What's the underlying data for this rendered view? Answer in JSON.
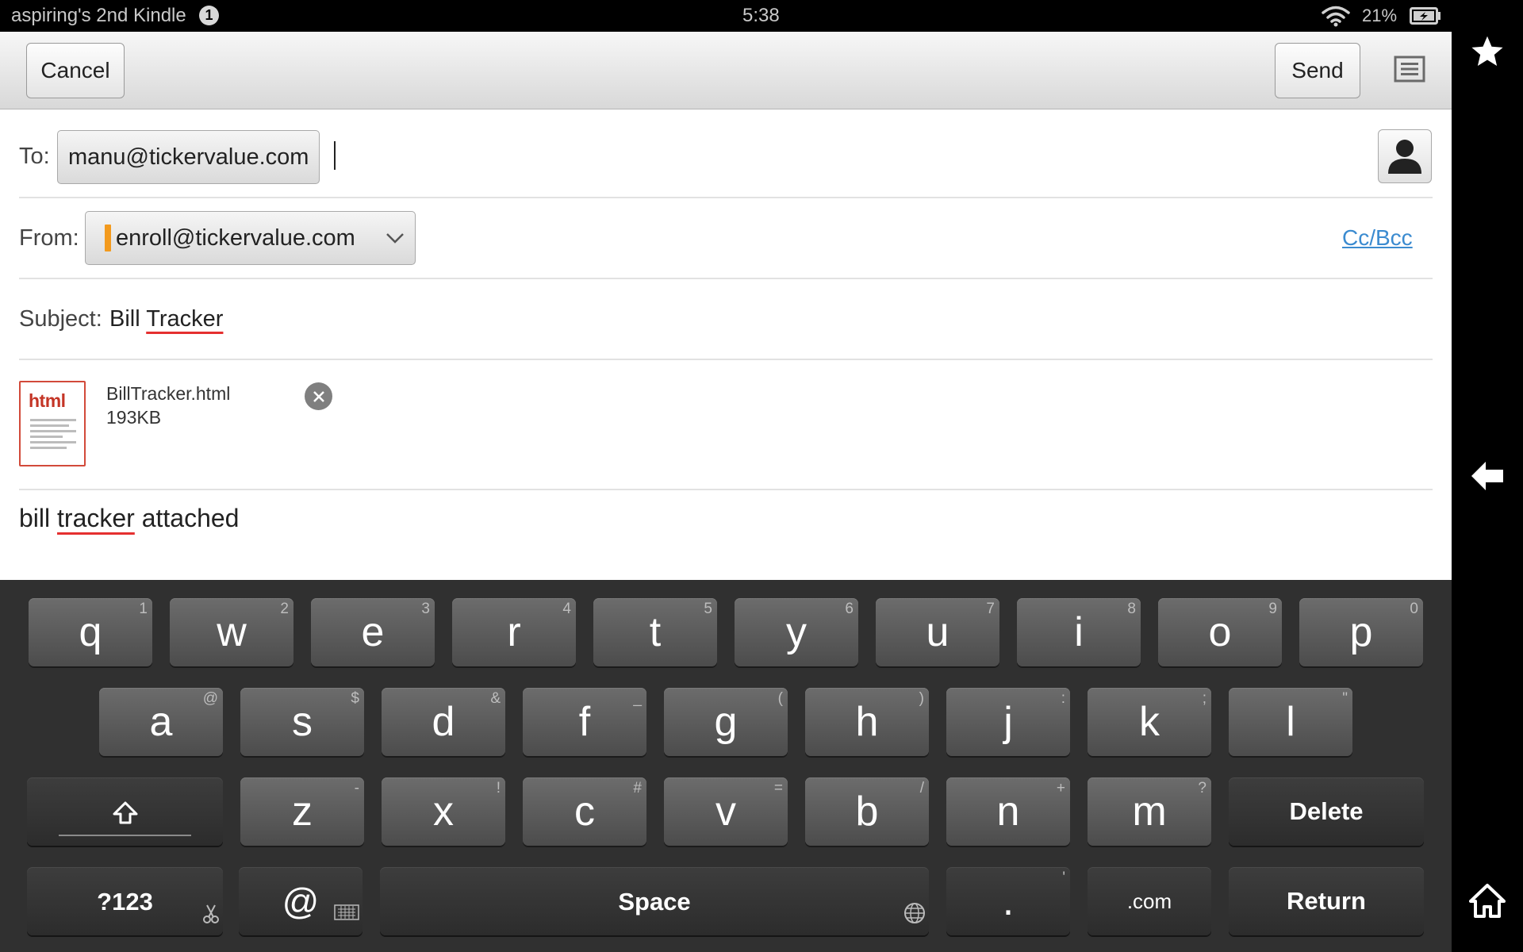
{
  "status_bar": {
    "device_name": "aspiring's 2nd Kindle",
    "notification_count": "1",
    "time": "5:38",
    "battery_percent": "21%"
  },
  "toolbar": {
    "cancel_label": "Cancel",
    "send_label": "Send"
  },
  "compose": {
    "to_label": "To:",
    "to_recipient": "manu@tickervalue.com",
    "from_label": "From:",
    "from_account": "enroll@tickervalue.com",
    "from_account_color": "#f39a1d",
    "cc_bcc_label": "Cc/Bcc",
    "subject_label": "Subject:",
    "subject_word1": "Bill",
    "subject_word2": "Tracker",
    "attachment": {
      "type_label": "html",
      "name": "BillTracker.html",
      "size": "193KB"
    },
    "body_word1": "bill",
    "body_word2": "tracker",
    "body_word3": "attached"
  },
  "keyboard": {
    "row1": [
      {
        "key": "q",
        "hint": "1"
      },
      {
        "key": "w",
        "hint": "2"
      },
      {
        "key": "e",
        "hint": "3"
      },
      {
        "key": "r",
        "hint": "4"
      },
      {
        "key": "t",
        "hint": "5"
      },
      {
        "key": "y",
        "hint": "6"
      },
      {
        "key": "u",
        "hint": "7"
      },
      {
        "key": "i",
        "hint": "8"
      },
      {
        "key": "o",
        "hint": "9"
      },
      {
        "key": "p",
        "hint": "0"
      }
    ],
    "row2": [
      {
        "key": "a",
        "hint": "@"
      },
      {
        "key": "s",
        "hint": "$"
      },
      {
        "key": "d",
        "hint": "&"
      },
      {
        "key": "f",
        "hint": "_"
      },
      {
        "key": "g",
        "hint": "("
      },
      {
        "key": "h",
        "hint": ")"
      },
      {
        "key": "j",
        "hint": ":"
      },
      {
        "key": "k",
        "hint": ";"
      },
      {
        "key": "l",
        "hint": "\""
      }
    ],
    "row3": [
      {
        "key": "z",
        "hint": "-"
      },
      {
        "key": "x",
        "hint": "!"
      },
      {
        "key": "c",
        "hint": "#"
      },
      {
        "key": "v",
        "hint": "="
      },
      {
        "key": "b",
        "hint": "/"
      },
      {
        "key": "n",
        "hint": "+"
      },
      {
        "key": "m",
        "hint": "?"
      }
    ],
    "delete_label": "Delete",
    "symbols_label": "?123",
    "at_label": "@",
    "space_label": "Space",
    "period_label": ".",
    "period_hint": "'",
    "dotcom_label": ".com",
    "return_label": "Return"
  },
  "icons": {
    "wifi": "wifi-icon",
    "battery": "battery-charging-icon",
    "menu": "list-menu-icon",
    "contact": "contact-person-icon",
    "remove": "close-icon",
    "favorites": "star-icon",
    "back": "back-arrow-icon",
    "home": "home-icon"
  }
}
